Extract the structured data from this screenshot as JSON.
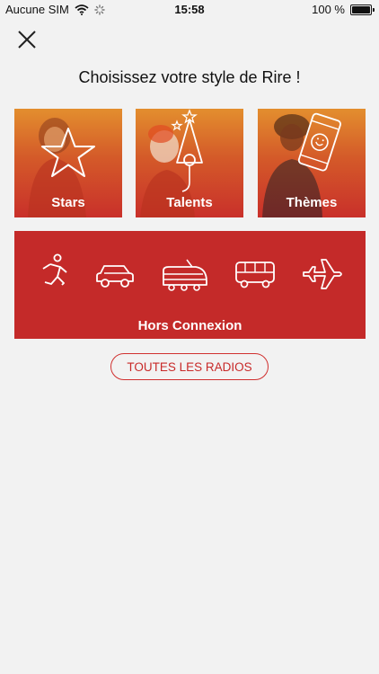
{
  "status_bar": {
    "carrier": "Aucune SIM",
    "time": "15:58",
    "battery_text": "100 %",
    "battery_level": 1.0
  },
  "header": {
    "close_icon": "close-icon",
    "title": "Choisissez votre style de Rire !"
  },
  "categories": [
    {
      "label": "Stars",
      "icon": "star-icon"
    },
    {
      "label": "Talents",
      "icon": "microphone-icon"
    },
    {
      "label": "Thèmes",
      "icon": "smartphone-icon"
    }
  ],
  "offline": {
    "label": "Hors Connexion",
    "icons": [
      "runner-icon",
      "car-icon",
      "train-icon",
      "bus-icon",
      "plane-icon"
    ]
  },
  "all_radios_button": "TOUTES LES RADIOS",
  "colors": {
    "accent_red": "#c42a29",
    "background": "#f2f2f2",
    "tile_gradient_top": "#e38e2e",
    "tile_gradient_bottom": "#c9302a"
  }
}
